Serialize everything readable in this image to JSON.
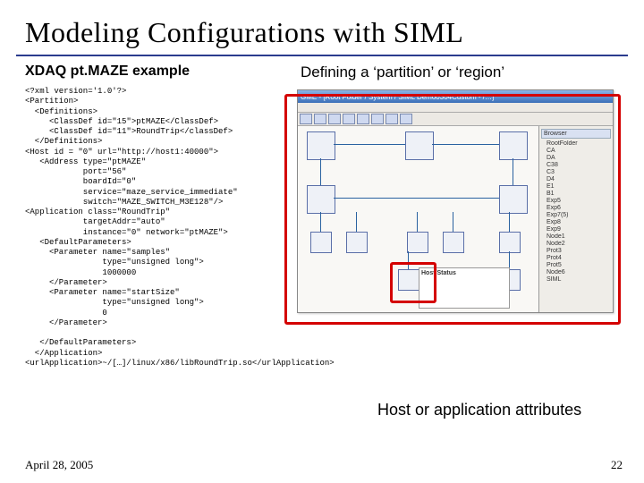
{
  "title": "Modeling Configurations with SIML",
  "subtitle": "XDAQ pt.MAZE example",
  "callout_partition": "Defining a ‘partition’ or ‘region’",
  "callout_attrs": "Host or application attributes",
  "footer": {
    "date": "April 28, 2005",
    "page": "22"
  },
  "code": "<?xml version='1.0'?>\n<Partition>\n  <Definitions>\n     <ClassDef id=\"15\">ptMAZE</ClassDef>\n     <ClassDef id=\"11\">RoundTrip</classDef>\n  </Definitions>\n<Host id = \"0\" url=\"http://host1:40000\">\n   <Address type=\"ptMAZE\"\n            port=\"56\"\n            boardId=\"0\"\n            service=\"maze_service_immediate\"\n            switch=\"MAZE_SWITCH_M3E128\"/>\n<Application class=\"RoundTrip\"\n            targetAddr=\"auto\"\n            instance=\"0\" network=\"ptMAZE\">\n   <DefaultParameters>\n     <Parameter name=\"samples\"\n                type=\"unsigned long\">\n                1000000\n     </Parameter>\n     <Parameter name=\"startSize\"\n                type=\"unsigned long\">\n                0\n     </Parameter>\n\n   </DefaultParameters>\n  </Application>\n<urlApplication>~/[…]/linux/x86/libRoundTrip.so</urlApplication>",
  "screenshot": {
    "titlebar": "GME - [Root Folder / System / SIML Demo0304Custom - /…]",
    "panel_header": "Browser",
    "tree": [
      "RootFolder",
      "CA",
      "DA",
      "C38",
      "C3",
      "D4",
      "E1",
      "B1",
      "Exp5",
      "Exp6",
      "Exp7(5)",
      "Exp8",
      "Exp9",
      "Node1",
      "Node2",
      "Prot3",
      "Prot4",
      "Prot5",
      "Node6",
      "SIML"
    ],
    "hoststatus_title": "Host/Status"
  }
}
